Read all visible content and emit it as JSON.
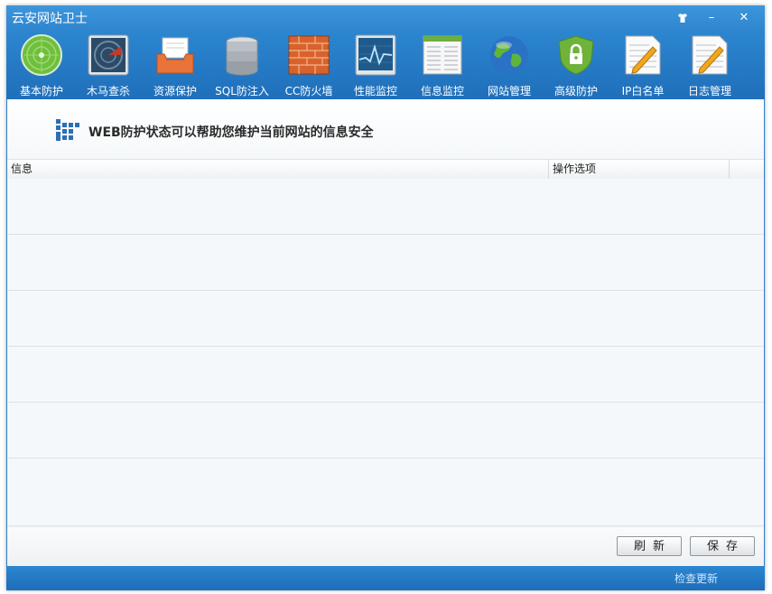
{
  "window": {
    "title": "云安网站卫士",
    "skin_icon": "shirt-icon",
    "minimize_label": "–",
    "close_label": "✕"
  },
  "toolbar": {
    "items": [
      {
        "label": "基本防护",
        "icon": "radar-icon"
      },
      {
        "label": "木马查杀",
        "icon": "scanner-icon"
      },
      {
        "label": "资源保护",
        "icon": "inbox-tray-icon"
      },
      {
        "label": "SQL防注入",
        "icon": "database-icon"
      },
      {
        "label": "CC防火墙",
        "icon": "brick-wall-icon"
      },
      {
        "label": "性能监控",
        "icon": "line-graph-icon"
      },
      {
        "label": "信息监控",
        "icon": "document-columns-icon"
      },
      {
        "label": "网站管理",
        "icon": "globe-icon"
      },
      {
        "label": "高级防护",
        "icon": "shield-lock-icon"
      },
      {
        "label": "IP白名单",
        "icon": "notepad-pencil-icon"
      },
      {
        "label": "日志管理",
        "icon": "notepad-pencil-icon"
      }
    ]
  },
  "banner": {
    "text": "WEB防护状态可以帮助您维护当前网站的信息安全"
  },
  "grid": {
    "columns": [
      "信息",
      "操作选项",
      ""
    ],
    "rows": [
      [],
      [],
      [],
      [],
      [],
      []
    ]
  },
  "buttons": {
    "refresh": "刷新",
    "save": "保存"
  },
  "status": {
    "update_link": "检查更新"
  },
  "colors": {
    "title_blue": "#2f86cf",
    "toolbar_blue": "#1f6fba",
    "content_bg": "#f4f7f9"
  }
}
